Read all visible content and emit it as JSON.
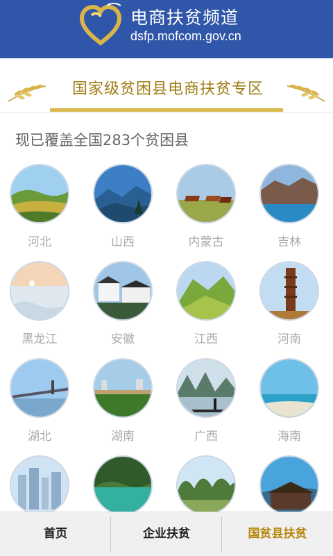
{
  "header": {
    "title": "电商扶贫频道",
    "url": "dsfp.mofcom.gov.cn"
  },
  "banner": {
    "title": "国家级贫困县电商扶贫专区"
  },
  "summary": "现已覆盖全国283个贫困县",
  "provinces": [
    {
      "label": "河北",
      "icon": "grassland-hills-image"
    },
    {
      "label": "山西",
      "icon": "mountain-forest-image"
    },
    {
      "label": "内蒙古",
      "icon": "horses-grassland-image"
    },
    {
      "label": "吉林",
      "icon": "lake-mountain-image"
    },
    {
      "label": "黑龙江",
      "icon": "snow-lake-image"
    },
    {
      "label": "安徽",
      "icon": "village-houses-image"
    },
    {
      "label": "江西",
      "icon": "green-mountains-image"
    },
    {
      "label": "河南",
      "icon": "pagoda-image"
    },
    {
      "label": "湖北",
      "icon": "bridge-river-image"
    },
    {
      "label": "湖南",
      "icon": "city-river-image"
    },
    {
      "label": "广西",
      "icon": "river-raft-image"
    },
    {
      "label": "海南",
      "icon": "sea-beach-image"
    },
    {
      "label": "",
      "icon": "city-skyline-image"
    },
    {
      "label": "",
      "icon": "forest-lake-image"
    },
    {
      "label": "",
      "icon": "karst-hills-image"
    },
    {
      "label": "",
      "icon": "wooden-house-image"
    }
  ],
  "nav": [
    {
      "label": "首页",
      "color": "#222222"
    },
    {
      "label": "企业扶贫",
      "color": "#222222"
    },
    {
      "label": "国贫县扶贫",
      "color": "#b8860b"
    }
  ],
  "colors": {
    "header_bg": "#2f56a8",
    "banner_text": "#a07c14",
    "active_nav": "#b8860b"
  }
}
